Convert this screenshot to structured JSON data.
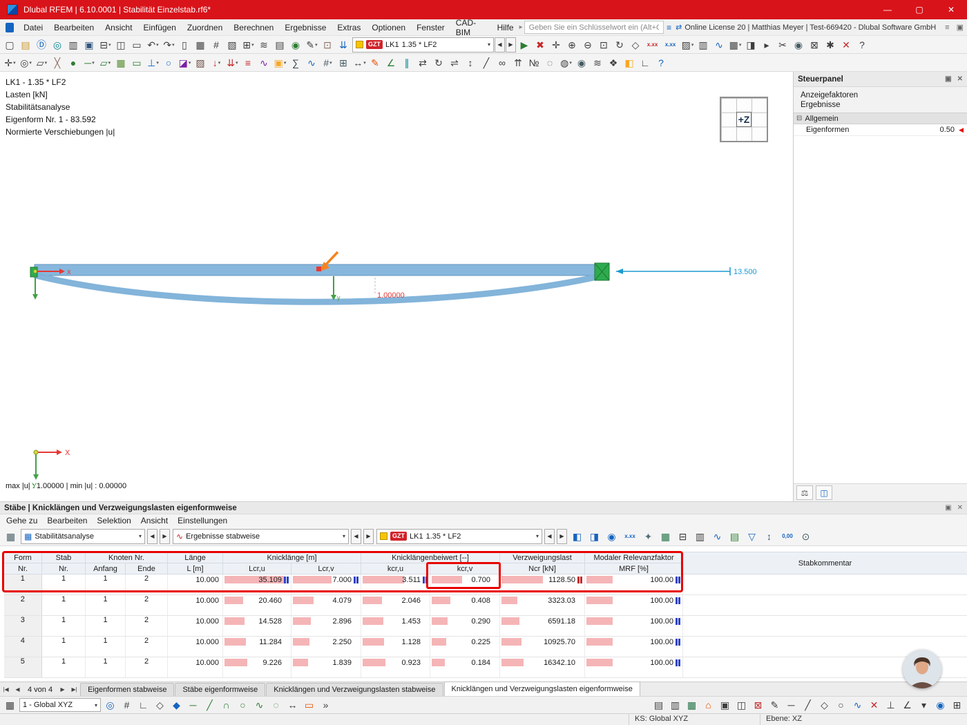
{
  "titlebar": {
    "title": "Dlubal RFEM | 6.10.0001 | Stabilität Einzelstab.rf6*",
    "min": "—",
    "max": "▢",
    "close": "✕"
  },
  "glyphs": {
    "dd": "▾",
    "prev": "◀",
    "next": "▶",
    "first": "|◀",
    "last": "▶|",
    "grid": "▦",
    "results_wave": "∿",
    "menu_arrow": "▸",
    "collapse_minus": "⊟",
    "red_marker": "◀",
    "float": "▣",
    "close": "✕",
    "more": "»",
    "scales": "⚖",
    "panel_toggle": "◫",
    "search_opts": "≡",
    "license": "⇄",
    "pin": "≡",
    "handle": "▥"
  },
  "menubar": {
    "items": [
      "Datei",
      "Bearbeiten",
      "Ansicht",
      "Einfügen",
      "Zuordnen",
      "Berechnen",
      "Ergebnisse",
      "Extras",
      "Optionen",
      "Fenster",
      "CAD-BIM",
      "Hilfe"
    ],
    "search_placeholder": "Geben Sie ein Schlüsselwort ein (Alt+Q)",
    "license": "Online License 20 | Matthias Meyer | Test-669420 - Dlubal Software GmbH"
  },
  "case_combo": {
    "badge": "GZT",
    "case": "LK1",
    "combo": "1.35 * LF2"
  },
  "toolbar1": {
    "left": [
      {
        "name": "new-model-icon",
        "g": "▢"
      },
      {
        "name": "open-file-icon",
        "g": "▤",
        "c": "#c9992e"
      },
      {
        "name": "dlubal-cloud-icon",
        "g": "Ⓓ",
        "c": "#1565c0"
      },
      {
        "name": "teamwork-icon",
        "g": "◎",
        "c": "#00838f"
      },
      {
        "name": "import-export-icon",
        "g": "▥"
      },
      {
        "name": "save-icon",
        "g": "▣",
        "c": "#30557d"
      },
      {
        "name": "print-icon",
        "g": "⊟",
        "dd": "▾"
      },
      {
        "name": "copy-icon",
        "g": "◫"
      },
      {
        "name": "note-icon",
        "g": "▭"
      },
      {
        "name": "undo-icon",
        "g": "↶",
        "dd": "▾"
      },
      {
        "name": "redo-icon",
        "g": "↷",
        "dd": "▾"
      },
      {
        "name": "table-column-icon",
        "g": "▯"
      },
      {
        "name": "table-grid-icon",
        "g": "▦"
      },
      {
        "name": "measure-icon",
        "g": "#"
      },
      {
        "name": "section-icon",
        "g": "▧"
      },
      {
        "name": "calculate-icon",
        "g": "⊞",
        "dd": "▾"
      },
      {
        "name": "check-model-icon",
        "g": "≋"
      },
      {
        "name": "report-icon",
        "g": "▤"
      },
      {
        "name": "globe-icon",
        "g": "◉",
        "c": "#2e7d32"
      },
      {
        "name": "pencil-edit-icon",
        "g": "✎",
        "dd": "▾"
      },
      {
        "name": "stamp-icon",
        "g": "⊡",
        "c": "#8d6e63"
      },
      {
        "name": "load-wizard-icon",
        "g": "⇊",
        "c": "#1565c0"
      }
    ],
    "right": [
      {
        "name": "start-calculation-icon",
        "g": "▶",
        "c": "#2e7d32"
      },
      {
        "name": "delete-results-icon",
        "g": "✖",
        "c": "#c62828"
      },
      {
        "name": "move-view-icon",
        "g": "✛"
      },
      {
        "name": "zoom-in-icon",
        "g": "⊕"
      },
      {
        "name": "zoom-out-icon",
        "g": "⊖"
      },
      {
        "name": "zoom-window-icon",
        "g": "⊡"
      },
      {
        "name": "rotate-view-icon",
        "g": "↻"
      },
      {
        "name": "isometric-view-icon",
        "g": "◇"
      },
      {
        "name": "result-values-red-icon",
        "g": "x.xx",
        "c": "#c62828",
        "cls": "sm"
      },
      {
        "name": "result-values-blue-icon",
        "g": "x.xx",
        "c": "#1565c0",
        "cls": "sm"
      },
      {
        "name": "render-mode-icon",
        "g": "▨",
        "dd": "▾"
      },
      {
        "name": "display-properties-icon",
        "g": "▥"
      },
      {
        "name": "result-diagram-icon",
        "g": "∿",
        "c": "#1565c0"
      },
      {
        "name": "table-toggle-icon",
        "g": "▦",
        "dd": "▾"
      },
      {
        "name": "panel-toggle-icon",
        "g": "◨"
      },
      {
        "name": "selection-arrow-icon",
        "g": "▸"
      },
      {
        "name": "clipping-icon",
        "g": "✂"
      },
      {
        "name": "visibility-icon",
        "g": "◉",
        "c": "#455a64"
      },
      {
        "name": "lock-icon",
        "g": "⊠"
      },
      {
        "name": "settings-icon",
        "g": "✱"
      },
      {
        "name": "cancel-icon",
        "g": "✕",
        "c": "#c62828"
      },
      {
        "name": "help-icon",
        "g": "?"
      }
    ]
  },
  "toolbar2": {
    "icons": [
      {
        "name": "edit-operations-icon",
        "g": "✛",
        "dd": "▾"
      },
      {
        "name": "snap-settings-icon",
        "g": "◎",
        "dd": "▾"
      },
      {
        "name": "work-plane-icon",
        "g": "▱",
        "dd": "▾"
      },
      {
        "name": "trim-icon",
        "g": "╳",
        "c": "#8d6e63"
      },
      {
        "name": "node-icon",
        "g": "●",
        "c": "#2e7d32"
      },
      {
        "name": "member-icon",
        "g": "─",
        "c": "#2e7d32",
        "dd": "▾"
      },
      {
        "name": "surface-icon",
        "g": "▱",
        "c": "#2e7d32",
        "dd": "▾"
      },
      {
        "name": "solid-icon",
        "g": "▦",
        "c": "#558b2f"
      },
      {
        "name": "opening-icon",
        "g": "▭",
        "c": "#2e7d32"
      },
      {
        "name": "nodal-support-icon",
        "g": "⊥",
        "c": "#1565c0",
        "dd": "▾"
      },
      {
        "name": "member-hinge-icon",
        "g": "○",
        "c": "#1565c0"
      },
      {
        "name": "cross-section-icon",
        "g": "◪",
        "c": "#7b1fa2",
        "dd": "▾"
      },
      {
        "name": "material-icon",
        "g": "▨",
        "c": "#6d4c41"
      },
      {
        "name": "nodal-load-icon",
        "g": "↓",
        "c": "#c62828",
        "dd": "▾"
      },
      {
        "name": "member-load-icon",
        "g": "⇊",
        "c": "#c62828",
        "dd": "▾"
      },
      {
        "name": "surface-load-icon",
        "g": "≡",
        "c": "#c62828"
      },
      {
        "name": "imperfection-icon",
        "g": "∿",
        "c": "#7b1fa2"
      },
      {
        "name": "load-case-icon",
        "g": "▣",
        "c": "#f9a825",
        "dd": "▾"
      },
      {
        "name": "combination-icon",
        "g": "∑",
        "c": "#37474f"
      },
      {
        "name": "result-beam-icon",
        "g": "∿",
        "c": "#1565c0"
      },
      {
        "name": "mesh-icon",
        "g": "#",
        "c": "#455a64",
        "dd": "▾"
      },
      {
        "name": "mesh-settings-icon",
        "g": "⊞",
        "c": "#455a64"
      },
      {
        "name": "dimension-icon",
        "g": "↔",
        "dd": "▾"
      },
      {
        "name": "annotation-icon",
        "g": "✎",
        "c": "#e65100"
      },
      {
        "name": "coordinate-system-icon",
        "g": "∠",
        "c": "#2e7d32"
      },
      {
        "name": "guide-line-icon",
        "g": "∥",
        "c": "#00838f"
      },
      {
        "name": "move-copy-icon",
        "g": "⇄"
      },
      {
        "name": "rotate-icon",
        "g": "↻"
      },
      {
        "name": "mirror-icon",
        "g": "⇌"
      },
      {
        "name": "scale-icon",
        "g": "↕"
      },
      {
        "name": "divide-member-icon",
        "g": "╱"
      },
      {
        "name": "connect-members-icon",
        "g": "∞"
      },
      {
        "name": "extrude-icon",
        "g": "⇈"
      },
      {
        "name": "renumber-icon",
        "g": "№"
      },
      {
        "name": "select-all-icon",
        "g": "◌"
      },
      {
        "name": "select-special-icon",
        "g": "◍",
        "dd": "▾"
      },
      {
        "name": "visibility-mode-icon",
        "g": "◉",
        "c": "#455a64"
      },
      {
        "name": "layers-icon",
        "g": "≋"
      },
      {
        "name": "blocks-icon",
        "g": "❖"
      },
      {
        "name": "paintbrush-icon",
        "g": "◧",
        "c": "#f9a825"
      },
      {
        "name": "measure-angle-icon",
        "g": "∟"
      },
      {
        "name": "help-pointer-icon",
        "g": "?",
        "c": "#1565c0"
      }
    ]
  },
  "viewport": {
    "info_lines": [
      "LK1 - 1.35 * LF2",
      "Lasten [kN]",
      "Stabilitätsanalyse",
      "Eigenform Nr. 1 - 83.592",
      "Normierte Verschiebungen |u|"
    ],
    "deform_label": "1.00000",
    "dimension_label": "13.500",
    "cube_label": "+Z",
    "axis": {
      "x": "X",
      "y": "Y",
      "bx": "x",
      "by": "y"
    },
    "maxmin": "max |u| : 1.00000 | min |u| : 0.00000"
  },
  "steuerpanel": {
    "title": "Steuerpanel",
    "links": [
      {
        "name": "link-anzeigefaktoren",
        "label": "Anzeigefaktoren"
      },
      {
        "name": "link-ergebnisse",
        "label": "Ergebnisse"
      }
    ],
    "group_label": "Allgemein",
    "row_label": "Eigenformen",
    "row_value": "0.50"
  },
  "panel": {
    "title": "Stäbe | Knicklängen und Verzweigungslasten eigenformweise",
    "menu": [
      "Gehe zu",
      "Bearbeiten",
      "Selektion",
      "Ansicht",
      "Einstellungen"
    ],
    "pre_icons": [
      {
        "name": "table-manager-icon",
        "g": "▦",
        "c": "#455a64"
      }
    ],
    "combo_analysis": "Stabilitätsanalyse",
    "combo_results": "Ergebnisse stabweise",
    "icons": [
      {
        "name": "select-relevant-rows-icon",
        "g": "◧",
        "c": "#1565c0"
      },
      {
        "name": "select-filter-icon",
        "g": "◨",
        "c": "#1565c0"
      },
      {
        "name": "show-values-eye-icon",
        "g": "◉",
        "c": "#1565c0"
      },
      {
        "name": "decimal-places-icon",
        "g": "x.xx",
        "c": "#1565c0",
        "cls": "sm"
      },
      {
        "name": "selection-person-icon",
        "g": "✦",
        "c": "#546e7a"
      },
      {
        "name": "export-excel-icon",
        "g": "▦",
        "c": "#1d6f42"
      },
      {
        "name": "print-table-icon",
        "g": "⊟"
      },
      {
        "name": "column-settings-icon",
        "g": "▥"
      },
      {
        "name": "chart-icon",
        "g": "∿",
        "c": "#1565c0"
      },
      {
        "name": "import-table-icon",
        "g": "▤",
        "c": "#2e7d32"
      },
      {
        "name": "filter-icon",
        "g": "▽",
        "c": "#1565c0"
      },
      {
        "name": "relevance-sort-icon",
        "g": "↕",
        "c": "#455a64"
      },
      {
        "name": "decimal-comma-icon",
        "g": "0,00",
        "c": "#1565c0",
        "cls": "sm"
      },
      {
        "name": "search-icon",
        "g": "⊙",
        "c": "#455a64"
      }
    ],
    "pager": "4 von 4",
    "tabs": [
      {
        "label": "Eigenformen stabweise"
      },
      {
        "label": "Stäbe eigenformweise"
      },
      {
        "label": "Knicklängen und Verzweigungslasten stabweise"
      },
      {
        "label": "Knicklängen und Verzweigungslasten eigenformweise",
        "active": true
      }
    ]
  },
  "table": {
    "headers": {
      "form": "Form",
      "stab": "Stab",
      "nr": "Nr.",
      "knoten": "Knoten Nr.",
      "anfang": "Anfang",
      "ende": "Ende",
      "laenge": "Länge",
      "l_m": "L [m]",
      "knicklaenge": "Knicklänge [m]",
      "lcru": "Lcr,u",
      "lcrv": "Lcr,v",
      "beiwert": "Knicklängenbeiwert [--]",
      "kcru": "kcr,u",
      "kcrv": "kcr,v",
      "verzweigungslast": "Verzweigungslast",
      "ncr": "Ncr [kN]",
      "modaler": "Modaler Relevanzfaktor",
      "mrf": "MRF [%]",
      "kommentar": "Stabkommentar"
    },
    "rows": [
      {
        "form": "1",
        "stab": "1",
        "anfang": "1",
        "ende": "2",
        "l": "10.000",
        "lcru": "35.109",
        "lcrv": "7.000",
        "kcru": "3.511",
        "kcrv": "0.700",
        "ncr": "1128.50",
        "mrf": "100.00",
        "bar": {
          "lcru": 86,
          "lcrv": 56,
          "kcru": 60,
          "kcrv": 44,
          "ncr": 60,
          "mrf": 38
        }
      },
      {
        "form": "2",
        "stab": "1",
        "anfang": "1",
        "ende": "2",
        "l": "10.000",
        "lcru": "20.460",
        "lcrv": "4.079",
        "kcru": "2.046",
        "kcrv": "0.408",
        "ncr": "3323.03",
        "mrf": "100.00",
        "bar": {
          "lcru": 27,
          "lcrv": 30,
          "kcru": 28,
          "kcrv": 27,
          "ncr": 23,
          "mrf": 38
        }
      },
      {
        "form": "3",
        "stab": "1",
        "anfang": "1",
        "ende": "2",
        "l": "10.000",
        "lcru": "14.528",
        "lcrv": "2.896",
        "kcru": "1.453",
        "kcrv": "0.290",
        "ncr": "6591.18",
        "mrf": "100.00",
        "bar": {
          "lcru": 29,
          "lcrv": 26,
          "kcru": 30,
          "kcrv": 23,
          "ncr": 26,
          "mrf": 38
        }
      },
      {
        "form": "4",
        "stab": "1",
        "anfang": "1",
        "ende": "2",
        "l": "10.000",
        "lcru": "11.284",
        "lcrv": "2.250",
        "kcru": "1.128",
        "kcrv": "0.225",
        "ncr": "10925.70",
        "mrf": "100.00",
        "bar": {
          "lcru": 31,
          "lcrv": 24,
          "kcru": 31,
          "kcrv": 21,
          "ncr": 29,
          "mrf": 38
        }
      },
      {
        "form": "5",
        "stab": "1",
        "anfang": "1",
        "ende": "2",
        "l": "10.000",
        "lcru": "9.226",
        "lcrv": "1.839",
        "kcru": "0.923",
        "kcrv": "0.184",
        "ncr": "16342.10",
        "mrf": "100.00",
        "bar": {
          "lcru": 33,
          "lcrv": 22,
          "kcru": 33,
          "kcrv": 19,
          "ncr": 32,
          "mrf": 38
        }
      }
    ]
  },
  "bottombar": {
    "cs_label": "1 - Global XYZ",
    "left_icons": [
      {
        "name": "snap-toggle-icon",
        "g": "◎",
        "c": "#1565c0"
      },
      {
        "name": "grid-snap-icon",
        "g": "#"
      },
      {
        "name": "ortho-icon",
        "g": "∟"
      },
      {
        "name": "polar-icon",
        "g": "◇"
      },
      {
        "name": "object-snap-icon",
        "g": "◆",
        "c": "#1565c0"
      },
      {
        "name": "line-tool-icon",
        "g": "─",
        "c": "#2e7d32"
      },
      {
        "name": "polyline-icon",
        "g": "╱",
        "c": "#2e7d32"
      },
      {
        "name": "arc-icon",
        "g": "∩",
        "c": "#2e7d32"
      },
      {
        "name": "circle-icon",
        "g": "○",
        "c": "#2e7d32"
      },
      {
        "name": "spline-icon",
        "g": "∿",
        "c": "#2e7d32"
      },
      {
        "name": "ellipse-icon",
        "g": "◌",
        "c": "#2e7d32"
      },
      {
        "name": "dimension-tool-icon",
        "g": "↔"
      },
      {
        "name": "comment-icon",
        "g": "▭",
        "c": "#e65100"
      },
      {
        "name": "more-tools-icon",
        "g": "»"
      }
    ],
    "right_icons": [
      {
        "name": "table-icon",
        "g": "▤"
      },
      {
        "name": "display-icon",
        "g": "▥"
      },
      {
        "name": "excel-icon",
        "g": "▦",
        "c": "#1d6f42"
      },
      {
        "name": "home-icon",
        "g": "⌂",
        "c": "#e65100"
      },
      {
        "name": "snapshot-icon",
        "g": "▣"
      },
      {
        "name": "windows-icon",
        "g": "◫"
      },
      {
        "name": "close-window-icon",
        "g": "⊠",
        "c": "#c62828"
      },
      {
        "name": "draw-icon",
        "g": "✎"
      },
      {
        "name": "line2-icon",
        "g": "─"
      },
      {
        "name": "diagonal-icon",
        "g": "╱"
      },
      {
        "name": "rhombus-icon",
        "g": "◇"
      },
      {
        "name": "circle2-icon",
        "g": "○"
      },
      {
        "name": "wave-icon",
        "g": "∿",
        "c": "#1565c0"
      },
      {
        "name": "delete-icon",
        "g": "✕",
        "c": "#c62828"
      },
      {
        "name": "perpendicular-icon",
        "g": "⊥"
      },
      {
        "name": "angle-icon",
        "g": "∠"
      },
      {
        "name": "dropdown-icon",
        "g": "▾"
      },
      {
        "name": "target-icon",
        "g": "◉",
        "c": "#1565c0"
      },
      {
        "name": "full-extent-icon",
        "g": "⊞"
      }
    ]
  },
  "statusbar": {
    "ks": "KS: Global XYZ",
    "ebene": "Ebene: XZ"
  },
  "colors": {
    "titlebar": "#d9131a",
    "highlight": "#e80000",
    "bar_pink": "#f5b5b7",
    "gzt_badge": "#d2232a",
    "beam_blue": "#87b7dd",
    "support_green": "#2eab4e",
    "arrow_orange": "#f58220",
    "dimension_blue": "#1b9ad2"
  }
}
